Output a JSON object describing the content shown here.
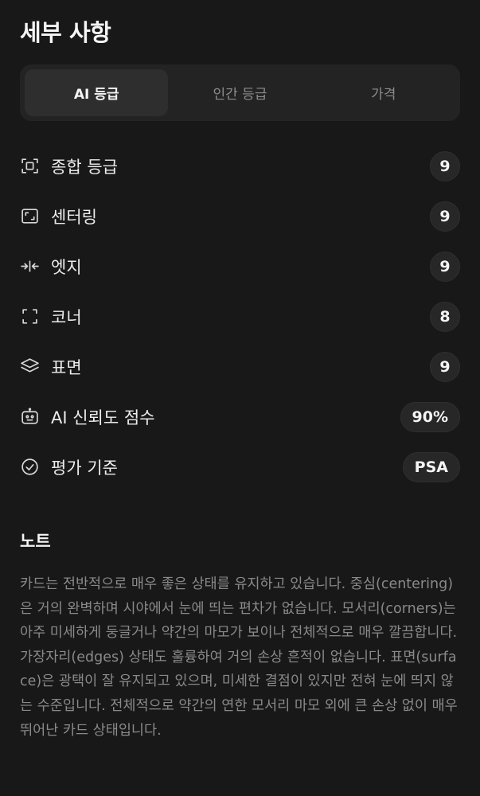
{
  "header": {
    "title": "세부 사항"
  },
  "tabs": [
    {
      "label": "AI 등급",
      "active": true
    },
    {
      "label": "인간 등급",
      "active": false
    },
    {
      "label": "가격",
      "active": false
    }
  ],
  "details": [
    {
      "icon": "focus-frame-icon",
      "label": "종합 등급",
      "value": "9"
    },
    {
      "icon": "centering-frame-icon",
      "label": "센터링",
      "value": "9"
    },
    {
      "icon": "edges-arrows-icon",
      "label": "엣지",
      "value": "9"
    },
    {
      "icon": "corners-icon",
      "label": "코너",
      "value": "8"
    },
    {
      "icon": "layers-icon",
      "label": "표면",
      "value": "9"
    },
    {
      "icon": "robot-icon",
      "label": "AI 신뢰도 점수",
      "value": "90%"
    },
    {
      "icon": "check-circle-icon",
      "label": "평가 기준",
      "value": "PSA"
    }
  ],
  "notes": {
    "title": "노트",
    "body": "카드는 전반적으로 매우 좋은 상태를 유지하고 있습니다. 중심(centering)은 거의 완벽하며 시야에서 눈에 띄는 편차가 없습니다. 모서리(corners)는 아주 미세하게 둥글거나 약간의 마모가 보이나 전체적으로 매우 깔끔합니다. 가장자리(edges) 상태도 훌륭하여 거의 손상 흔적이 없습니다. 표면(surface)은 광택이 잘 유지되고 있으며, 미세한 결점이 있지만 전혀 눈에 띄지 않는 수준입니다. 전체적으로 약간의 연한 모서리 마모 외에 큰 손상 없이 매우 뛰어난 카드 상태입니다."
  }
}
